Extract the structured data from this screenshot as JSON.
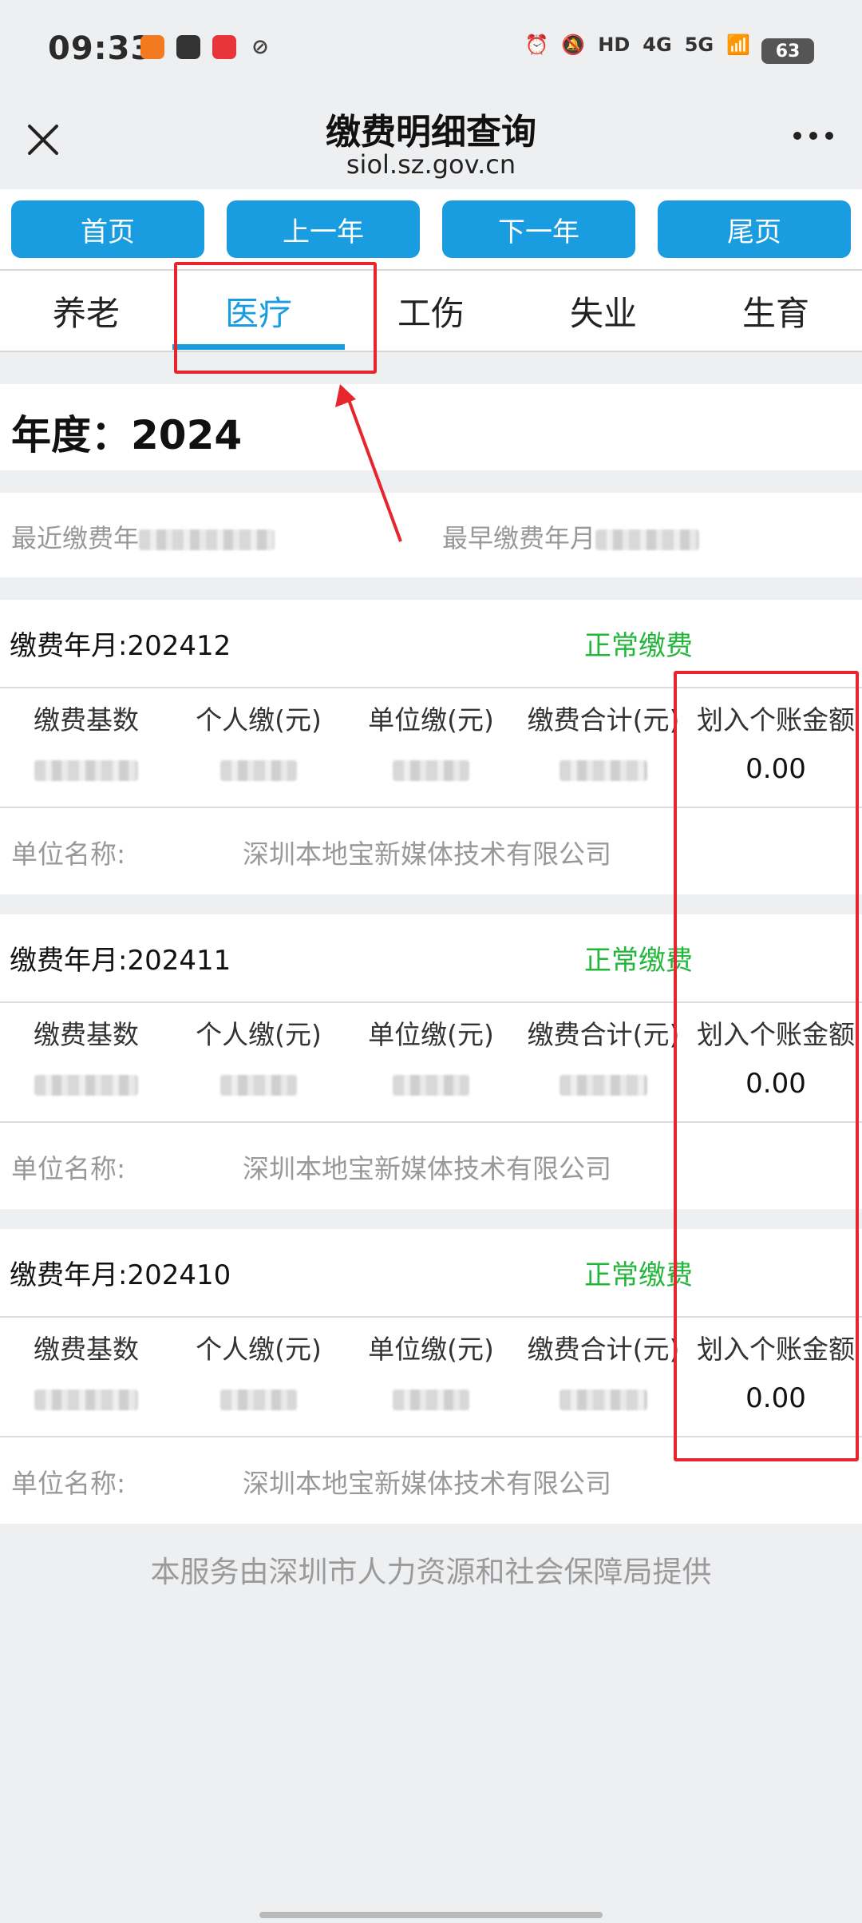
{
  "status_bar": {
    "time": "09:33",
    "network": [
      "HD",
      "4G",
      "5G"
    ],
    "battery": "63"
  },
  "header": {
    "title": "缴费明细查询",
    "url": "siol.sz.gov.cn"
  },
  "nav_buttons": [
    "首页",
    "上一年",
    "下一年",
    "尾页"
  ],
  "tabs": {
    "items": [
      "养老",
      "医疗",
      "工伤",
      "失业",
      "生育"
    ],
    "active": "医疗"
  },
  "year_label": "年度：2024",
  "summary": {
    "latest_label": "最近缴费年",
    "earliest_label": "最早缴费年月"
  },
  "columns": [
    "缴费基数",
    "个人缴(元)",
    "单位缴(元)",
    "缴费合计(元)",
    "划入个账金额"
  ],
  "records": [
    {
      "month": "缴费年月:202412",
      "status": "正常缴费",
      "account_amount": "0.00",
      "unit_label": "单位名称:",
      "unit_name": "深圳本地宝新媒体技术有限公司"
    },
    {
      "month": "缴费年月:202411",
      "status": "正常缴费",
      "account_amount": "0.00",
      "unit_label": "单位名称:",
      "unit_name": "深圳本地宝新媒体技术有限公司"
    },
    {
      "month": "缴费年月:202410",
      "status": "正常缴费",
      "account_amount": "0.00",
      "unit_label": "单位名称:",
      "unit_name": "深圳本地宝新媒体技术有限公司"
    }
  ],
  "footer": "本服务由深圳市人力资源和社会保障局提供",
  "colors": {
    "accent": "#1a9ce0",
    "status_green": "#22b73a",
    "annotation_red": "#e6262c"
  }
}
